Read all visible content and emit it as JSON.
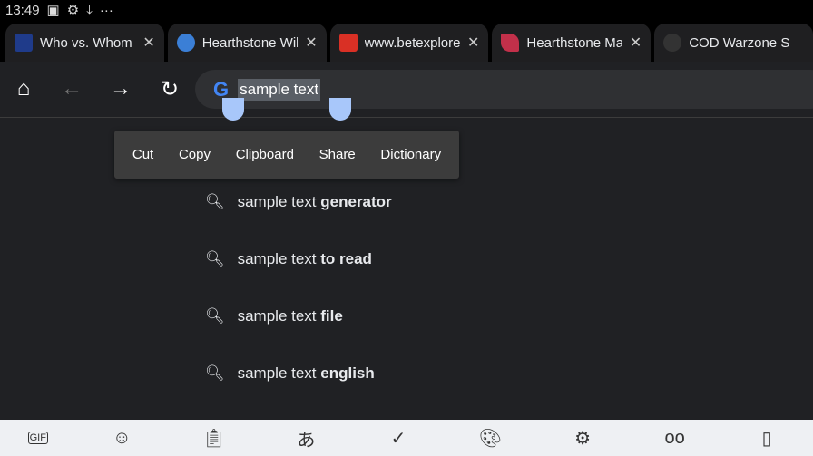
{
  "status": {
    "time": "13:49",
    "icons": [
      "image-icon",
      "settings-icon",
      "download-icon",
      "more-icon"
    ]
  },
  "tabs": [
    {
      "title": "Who vs. Whom |",
      "favicon_color": "#1f3b8a"
    },
    {
      "title": "Hearthstone Wil",
      "favicon_color": "#3b7fd6"
    },
    {
      "title": "www.betexplorer",
      "favicon_color": "#d93025"
    },
    {
      "title": "Hearthstone Ma",
      "favicon_color": "#c2304a"
    },
    {
      "title": "COD Warzone S",
      "favicon_color": "#333333"
    }
  ],
  "omnibox": {
    "text": "sample text"
  },
  "context_menu": [
    "Cut",
    "Copy",
    "Clipboard",
    "Share",
    "Dictionary"
  ],
  "suggestions": [
    {
      "prefix": "sample text",
      "bold": "generator"
    },
    {
      "prefix": "sample text",
      "bold": "to read"
    },
    {
      "prefix": "sample text",
      "bold": "file"
    },
    {
      "prefix": "sample text",
      "bold": "english"
    }
  ],
  "keyboard_toolbar": [
    "gif-icon",
    "sticker-icon",
    "clipboard-icon",
    "translate-icon",
    "spellcheck-icon",
    "palette-icon",
    "keyboard-settings-icon",
    "incognito-icon"
  ]
}
